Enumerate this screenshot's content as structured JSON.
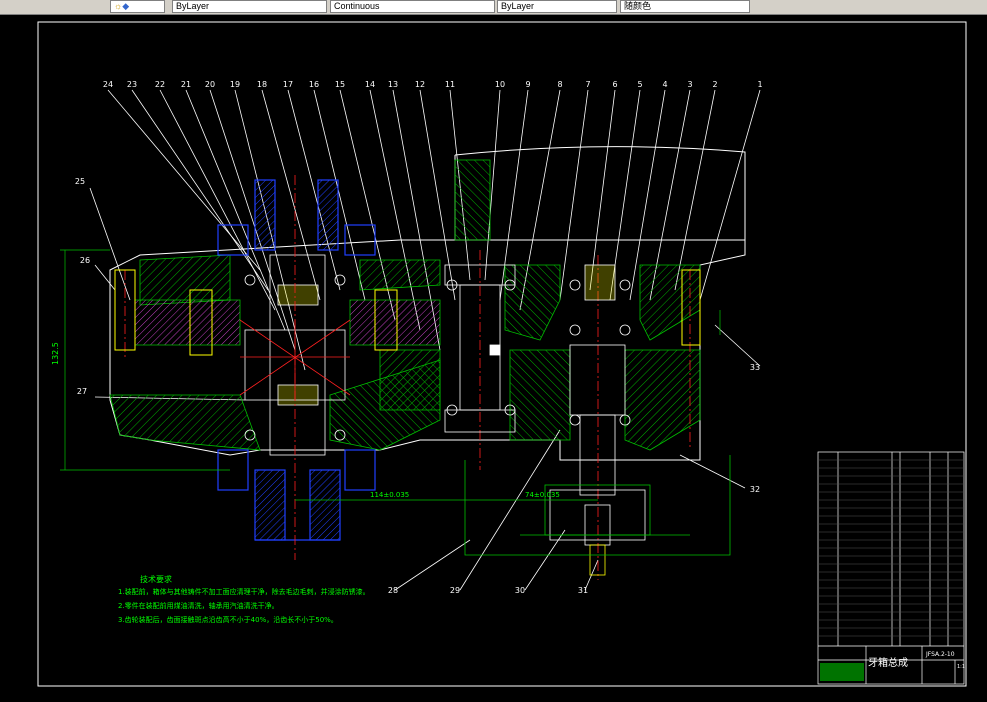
{
  "toolbar": {
    "cells": [
      "ByLayer",
      "Continuous",
      "ByLayer",
      "随颜色"
    ]
  },
  "drawing": {
    "part_numbers_top": [
      "24",
      "23",
      "22",
      "21",
      "20",
      "19",
      "18",
      "17",
      "16",
      "15",
      "14",
      "13",
      "12",
      "11",
      "10",
      "9",
      "8",
      "7",
      "6",
      "5",
      "4",
      "3",
      "2",
      "1"
    ],
    "part_numbers_side": [
      "25",
      "26",
      "27",
      "33",
      "32"
    ],
    "part_numbers_bottom": [
      "28",
      "29",
      "30",
      "31"
    ],
    "dim_height": "132.5",
    "dim_bottom_1": "114±0.035",
    "dim_bottom_2": "74±0.035",
    "tech_req_title": "技术要求",
    "tech_req_lines": [
      "1.装配前，箱体与其他铸件不加工面应清理干净，除去毛边毛刺，并浸涂防锈漆。",
      "2.零件在装配前用煤油清洗，轴承用汽油清洗干净。",
      "3.齿轮装配后，齿面接触斑点沿齿高不小于40%，沿齿长不小于50%。"
    ]
  },
  "title_block": {
    "title": "牙箱总成",
    "drawing_no": "JFSA.2-10",
    "scale": "1:1"
  },
  "colors": {
    "background": "#000000",
    "hatch": "#00c000",
    "outline": "#ffffff",
    "blue_parts": "#2040ff",
    "red_center": "#ff2020",
    "yellow_bolts": "#ffff00",
    "text_green": "#00ff00"
  }
}
